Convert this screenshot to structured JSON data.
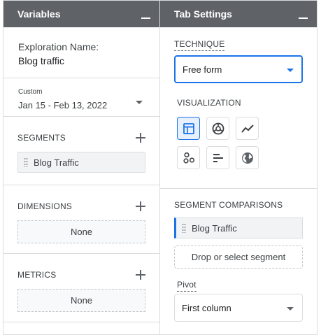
{
  "variables": {
    "header": "Variables",
    "exploration_label": "Exploration Name:",
    "exploration_name": "Blog traffic",
    "date_tag": "Custom",
    "date_range": "Jan 15 - Feb 13, 2022",
    "segments": {
      "title": "SEGMENTS",
      "items": [
        "Blog Traffic"
      ]
    },
    "dimensions": {
      "title": "DIMENSIONS",
      "empty_label": "None"
    },
    "metrics": {
      "title": "METRICS",
      "empty_label": "None"
    }
  },
  "tab_settings": {
    "header": "Tab Settings",
    "technique_label": "TECHNIQUE",
    "technique_value": "Free form",
    "visualization_label": "VISUALIZATION",
    "visualizations": [
      "table-icon",
      "donut-chart-icon",
      "line-chart-icon",
      "scatter-plot-icon",
      "bar-chart-icon",
      "geo-map-icon"
    ],
    "segment_comparisons_label": "SEGMENT COMPARISONS",
    "segment_comparisons": [
      "Blog Traffic"
    ],
    "drop_label": "Drop or select segment",
    "pivot_label": "Pivot",
    "pivot_value": "First column"
  },
  "colors": {
    "header_bg": "#5f6368",
    "accent": "#1a73e8",
    "border": "#dadce0"
  }
}
